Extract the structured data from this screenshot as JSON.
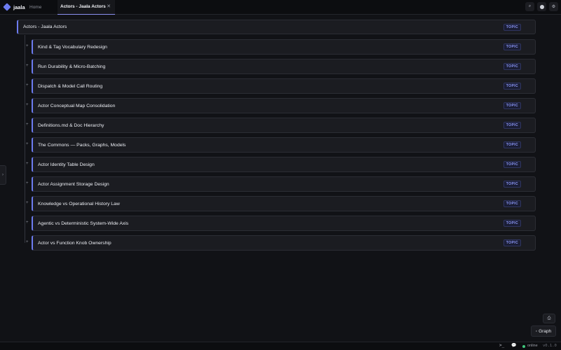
{
  "app": {
    "name": "jaala"
  },
  "tabs": [
    {
      "label": "Home"
    },
    {
      "label": "Actors - Jaala Actors",
      "close": "✕"
    }
  ],
  "top_icons": {
    "search": "⌕",
    "settings": "⚙"
  },
  "side_handle": {
    "glyph": "›"
  },
  "tree": {
    "root": {
      "title": "Actors - Jaala Actors",
      "badge": "TOPIC"
    },
    "expand_glyph": "+",
    "children": [
      {
        "title": "Kind & Tag Vocabulary Redesign",
        "badge": "TOPIC"
      },
      {
        "title": "Run Durability & Micro-Batching",
        "badge": "TOPIC"
      },
      {
        "title": "Dispatch & Model Call Routing",
        "badge": "TOPIC"
      },
      {
        "title": "Actor Conceptual Map Consolidation",
        "badge": "TOPIC"
      },
      {
        "title": "Definitions.md & Doc Hierarchy",
        "badge": "TOPIC"
      },
      {
        "title": "The Commons — Packs, Graphs, Models",
        "badge": "TOPIC"
      },
      {
        "title": "Actor Identity Table Design",
        "badge": "TOPIC"
      },
      {
        "title": "Actor Assignment Storage Design",
        "badge": "TOPIC"
      },
      {
        "title": "Knowledge vs Operational History Law",
        "badge": "TOPIC"
      },
      {
        "title": "Agentic vs Deterministic System-Wide Axis",
        "badge": "TOPIC"
      },
      {
        "title": "Actor vs Function Knob Ownership",
        "badge": "TOPIC"
      }
    ]
  },
  "floating": {
    "print_icon": "⎙",
    "graph_label": "Graph",
    "graph_glyph": "◦"
  },
  "status": {
    "terminal": ">_",
    "chat": "💬",
    "online": "online",
    "version": "v0.1.0"
  },
  "colors": {
    "accent": "#6d7cf0",
    "online": "#3fc77d",
    "badge_text": "#8f9bff"
  }
}
